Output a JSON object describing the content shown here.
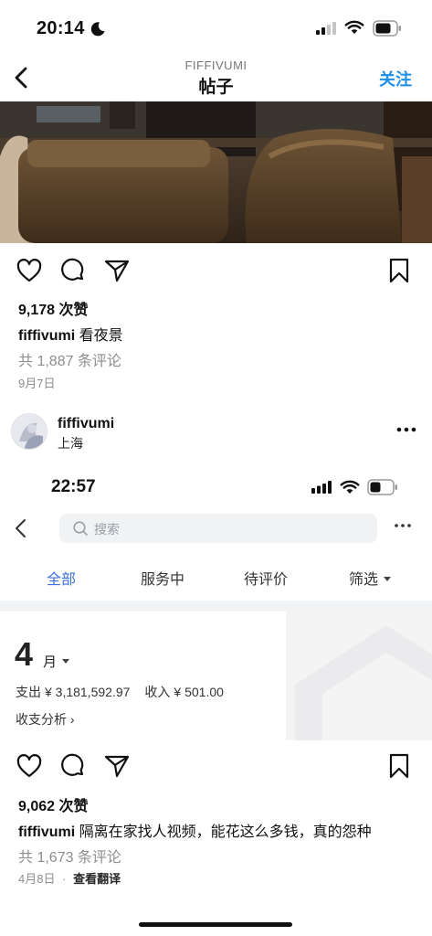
{
  "status_bar": {
    "time": "20:14"
  },
  "nav": {
    "subtitle": "FIFFIVUMI",
    "title": "帖子",
    "follow_label": "关注"
  },
  "post1": {
    "likes": "9,178 次赞",
    "username": "fiffivumi",
    "caption": "看夜景",
    "comments": "共 1,887 条评论",
    "date": "9月7日"
  },
  "post2_header": {
    "username": "fiffivumi",
    "location": "上海"
  },
  "embedded_screenshot": {
    "time": "22:57",
    "search_placeholder": "搜索",
    "tabs": [
      {
        "label": "全部",
        "active": true
      },
      {
        "label": "服务中",
        "active": false
      },
      {
        "label": "待评价",
        "active": false
      },
      {
        "label": "筛选",
        "active": false
      }
    ],
    "month_number": "4",
    "month_unit": "月",
    "expense_label": "支出",
    "expense_value": "¥ 3,181,592.97",
    "income_label": "收入",
    "income_value": "¥ 501.00",
    "analysis_label": "收支分析 ›",
    "accent": "#3b72d6"
  },
  "post2": {
    "likes": "9,062 次赞",
    "username": "fiffivumi",
    "caption": "隔离在家找人视频，能花这么多钱，真的怨种",
    "comments": "共 1,673 条评论",
    "date": "4月8日",
    "separator": "·",
    "translate": "查看翻译"
  },
  "colors": {
    "link_blue": "#1d8fe8",
    "muted": "#8e8e8e"
  }
}
